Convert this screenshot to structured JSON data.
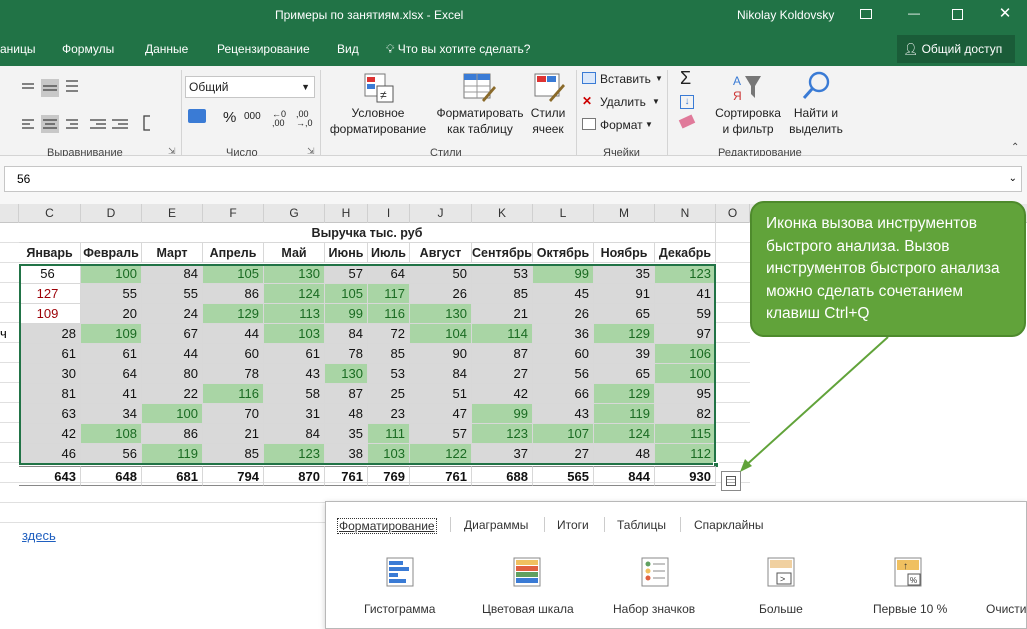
{
  "title": "Примеры по занятиям.xlsx - Excel",
  "user": "Nikolay Koldovsky",
  "menu": [
    "аницы",
    "Формулы",
    "Данные",
    "Рецензирование",
    "Вид"
  ],
  "tell_me": "Что вы хотите сделать?",
  "share": "Общий доступ",
  "ribbon": {
    "format_value": "Общий",
    "cond_fmt": "Условное\nформатирование",
    "fmt_table": "Форматировать\nкак таблицу",
    "cell_styles": "Стили\nячеек",
    "insert": "Вставить",
    "delete": "Удалить",
    "format": "Формат",
    "sort": "Сортировка\nи фильтр",
    "find": "Найти и\nвыделить",
    "percent": "%",
    "thousands": "000",
    "groups": [
      "Выравнивание",
      "Число",
      "Стили",
      "Ячейки",
      "Редактирование"
    ]
  },
  "formula_value": "56",
  "columns": [
    "C",
    "D",
    "E",
    "F",
    "G",
    "H",
    "I",
    "J",
    "K",
    "L",
    "M",
    "N",
    "O"
  ],
  "table_title": "Выручка тыс. руб",
  "months": [
    "Январь",
    "Февраль",
    "Март",
    "Апрель",
    "Май",
    "Июнь",
    "Июль",
    "Август",
    "Сентябрь",
    "Октябрь",
    "Ноябрь",
    "Декабрь"
  ],
  "rows": [
    [
      56,
      100,
      84,
      105,
      130,
      57,
      64,
      50,
      53,
      99,
      35,
      123
    ],
    [
      127,
      55,
      55,
      86,
      124,
      105,
      117,
      26,
      85,
      45,
      91,
      41
    ],
    [
      109,
      20,
      24,
      129,
      113,
      99,
      116,
      130,
      21,
      26,
      65,
      59
    ],
    [
      28,
      109,
      67,
      44,
      103,
      84,
      72,
      104,
      114,
      36,
      129,
      97
    ],
    [
      61,
      61,
      44,
      60,
      61,
      78,
      85,
      90,
      87,
      60,
      39,
      106
    ],
    [
      30,
      64,
      80,
      78,
      43,
      130,
      53,
      84,
      27,
      56,
      65,
      100
    ],
    [
      81,
      41,
      22,
      116,
      58,
      87,
      25,
      51,
      42,
      66,
      129,
      95
    ],
    [
      63,
      34,
      100,
      70,
      31,
      48,
      23,
      47,
      99,
      43,
      119,
      82
    ],
    [
      42,
      108,
      86,
      21,
      84,
      35,
      111,
      57,
      123,
      107,
      124,
      115
    ],
    [
      46,
      56,
      119,
      85,
      123,
      38,
      103,
      122,
      37,
      27,
      48,
      112
    ]
  ],
  "totals": [
    643,
    648,
    681,
    794,
    870,
    761,
    769,
    761,
    688,
    565,
    844,
    930
  ],
  "row_left_text": "ч",
  "link_text": "здесь",
  "callout": "Иконка вызова инструментов быстрого анализа. Вызов инструментов быстрого анализа можно сделать сочетанием клавиш Ctrl+Q",
  "quick_analysis": {
    "tabs": [
      "Форматирование",
      "Диаграммы",
      "Итоги",
      "Таблицы",
      "Спарклайны"
    ],
    "items": [
      "Гистограмма",
      "Цветовая шкала",
      "Набор значков",
      "Больше",
      "Первые 10 %",
      "Очисти"
    ]
  }
}
